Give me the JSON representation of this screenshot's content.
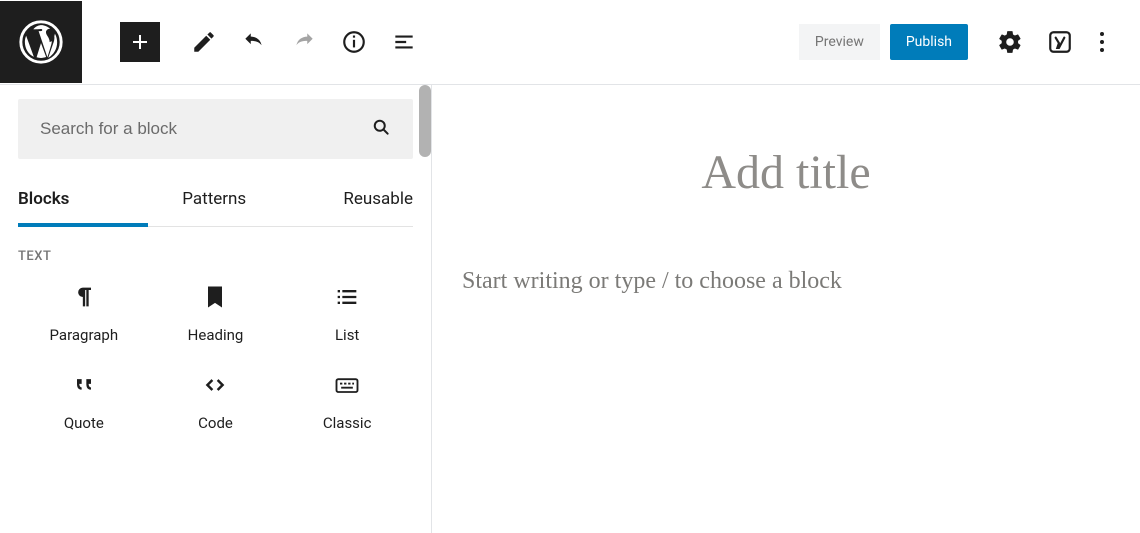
{
  "toolbar": {
    "preview_label": "Preview",
    "publish_label": "Publish"
  },
  "inserter": {
    "search_placeholder": "Search for a block",
    "tabs": {
      "blocks": "Blocks",
      "patterns": "Patterns",
      "reusable": "Reusable"
    },
    "category": "TEXT",
    "blocks": {
      "paragraph": "Paragraph",
      "heading": "Heading",
      "list": "List",
      "quote": "Quote",
      "code": "Code",
      "classic": "Classic"
    }
  },
  "editor": {
    "title_placeholder": "Add title",
    "body_placeholder": "Start writing or type / to choose a block"
  },
  "colors": {
    "accent": "#007cba",
    "dark": "#1e1e1e"
  }
}
